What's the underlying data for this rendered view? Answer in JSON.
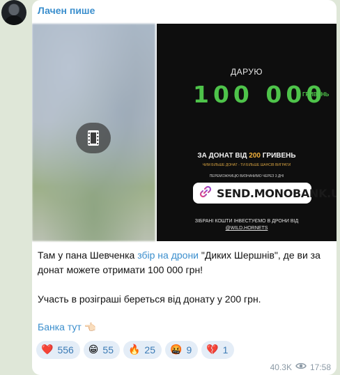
{
  "message": {
    "author": "Лачен пише",
    "avatar_icon": "user-avatar",
    "media": {
      "video_icon": "film-icon",
      "poster": {
        "daryu": "ДАРУЮ",
        "big_number": "100 000",
        "hryven": "ГРИВЕНЬ",
        "donat_prefix": "ЗА ДОНАТ ВІД ",
        "donat_amount": "200",
        "donat_suffix": " ГРИВЕНЬ",
        "chym_bilshe": "ЧИМ БІЛЬШЕ ДОНАТ - ТИ БІЛЬШЕ ШАНСІВ ВИГРАТИ",
        "peremozhtsia": "ПЕРЕМОЖНИЦЮ ВИЗНАЧИМО ЧЕРЕЗ 3 ДНІ",
        "link_label": "SEND.MONOBANK.UA",
        "invest_line1": "ЗІБРАНІ КОШТИ ІНВЕСТУЄМО В ДРОНИ ВІД",
        "invest_line2": "@WILD.HORNETS"
      }
    },
    "text": {
      "p1_part1": "Там у пана Шевченка ",
      "p1_link": "збір на дрони",
      "p1_part2": " \"Диких Шершнів\", де ви за донат можете отримати 100 000 грн!",
      "p2": "Участь в розіграші береться від донату у 200 грн."
    },
    "bank_link": "Банка тут",
    "bank_emoji": "👈🏻",
    "reactions": [
      {
        "emoji": "❤️",
        "icon": "red-heart-emoji",
        "count": "556"
      },
      {
        "emoji": "😁",
        "icon": "grinning-face-emoji",
        "count": "55"
      },
      {
        "emoji": "🔥",
        "icon": "fire-emoji",
        "count": "25"
      },
      {
        "emoji": "🤬",
        "icon": "cursing-face-emoji",
        "count": "9"
      },
      {
        "emoji": "💔",
        "icon": "broken-heart-emoji",
        "count": "1"
      }
    ],
    "views": "40.3K",
    "time": "17:58"
  },
  "colors": {
    "link": "#3a8ecd",
    "poster_green": "#4ec34a",
    "poster_accent": "#f3b23d",
    "chat_background": "#dfe7d8"
  }
}
